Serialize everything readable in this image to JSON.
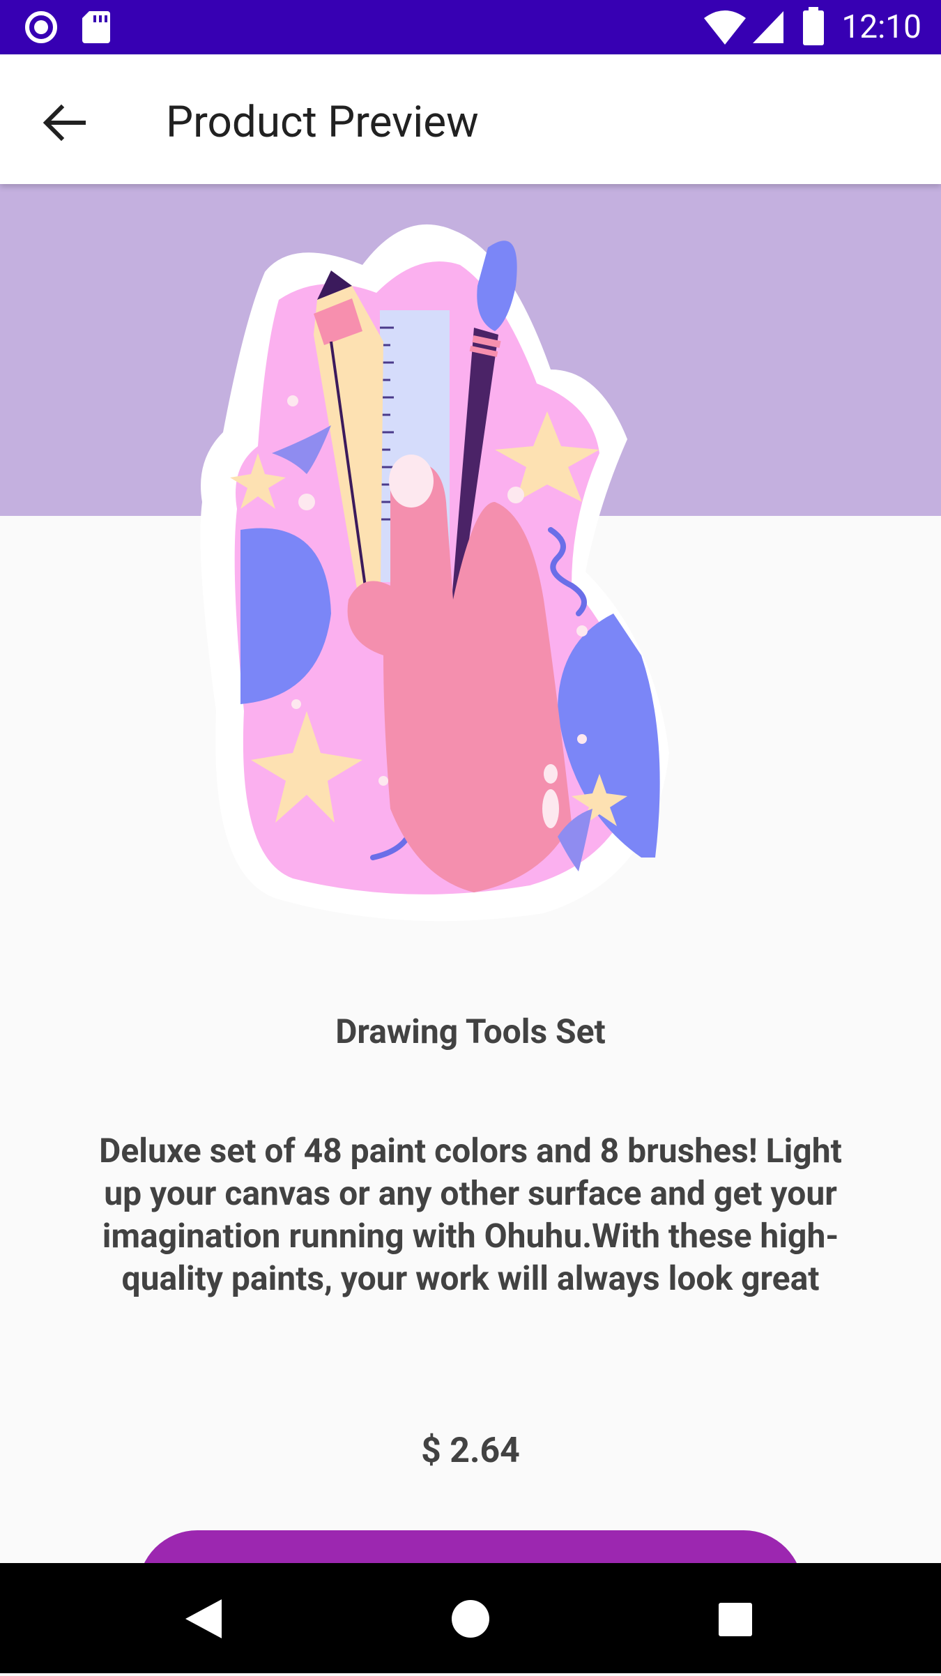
{
  "status_bar": {
    "time": "12:10",
    "icons": [
      "radio-circle-icon",
      "sd-card-icon",
      "wifi-icon",
      "signal-icon",
      "battery-icon"
    ]
  },
  "app_bar": {
    "title": "Product Preview",
    "back_icon": "arrow-back-icon"
  },
  "product": {
    "name": "Drawing Tools Set",
    "description": "Deluxe set of 48 paint colors and 8 brushes! Light up your canvas or any other surface and get your imagination running with Ohuhu.With these high-quality paints, your work will always look great",
    "price": "$ 2.64"
  },
  "cta": {
    "label": ""
  },
  "nav_bar": {
    "icons": [
      "back-triangle-icon",
      "home-circle-icon",
      "recents-square-icon"
    ]
  },
  "colors": {
    "status_bar": "#3700b3",
    "hero_background": "#c4b0df",
    "accent_button": "#9c27b0",
    "text": "#424242"
  }
}
